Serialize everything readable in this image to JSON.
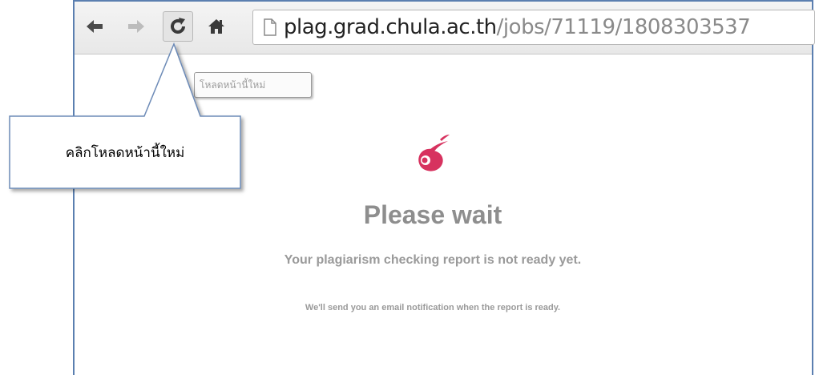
{
  "browser": {
    "url_host": "plag.grad.chula.ac.th",
    "url_path": "/jobs/71119/1808303537",
    "reload_tooltip": "โหลดหน้านี้ใหม่"
  },
  "callout": {
    "text": "คลิกโหลดหน้านี้ใหม่"
  },
  "page": {
    "title": "Please wait",
    "subtitle": "Your plagiarism checking report is not ready yet.",
    "note": "We'll send you an email notification when the report is ready."
  },
  "colors": {
    "logo": "#d7325f",
    "frame": "#5b7fb0",
    "callout_border": "#6d8bb7"
  },
  "icons": [
    "back-arrow-icon",
    "forward-arrow-icon",
    "reload-icon",
    "home-icon",
    "page-icon",
    "logo-icon"
  ]
}
